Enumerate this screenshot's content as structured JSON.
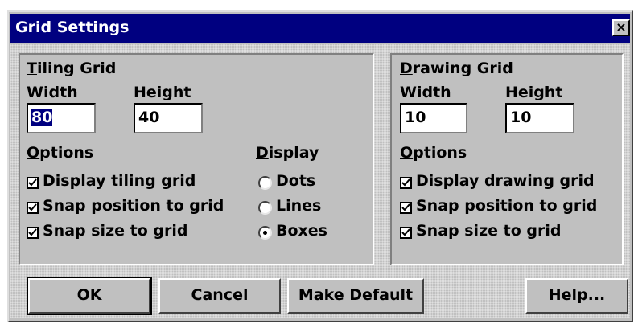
{
  "window": {
    "title": "Grid Settings",
    "close_glyph": "×"
  },
  "tiling": {
    "title_u": "T",
    "title_rest": "iling Grid",
    "width_label": "Width",
    "height_label": "Height",
    "width_value": "80",
    "height_value": "40",
    "options_u": "O",
    "options_rest": "ptions",
    "display_u": "D",
    "display_rest": "isplay",
    "options": [
      {
        "label": "Display tiling grid",
        "checked": true
      },
      {
        "label": "Snap position to grid",
        "checked": true
      },
      {
        "label": "Snap size to grid",
        "checked": true
      }
    ],
    "display": [
      {
        "label": "Dots",
        "selected": false
      },
      {
        "label": "Lines",
        "selected": false
      },
      {
        "label": "Boxes",
        "selected": true
      }
    ]
  },
  "drawing": {
    "title_u": "D",
    "title_rest": "rawing Grid",
    "width_label": "Width",
    "height_label": "Height",
    "width_value": "10",
    "height_value": "10",
    "options_u": "O",
    "options_rest": "ptions",
    "options": [
      {
        "label": "Display drawing grid",
        "checked": true
      },
      {
        "label": "Snap position to grid",
        "checked": true
      },
      {
        "label": "Snap size to grid",
        "checked": true
      }
    ]
  },
  "buttons": {
    "ok": "OK",
    "cancel": "Cancel",
    "make_default_pre": "Make ",
    "make_default_u": "D",
    "make_default_post": "efault",
    "help": "Help..."
  }
}
